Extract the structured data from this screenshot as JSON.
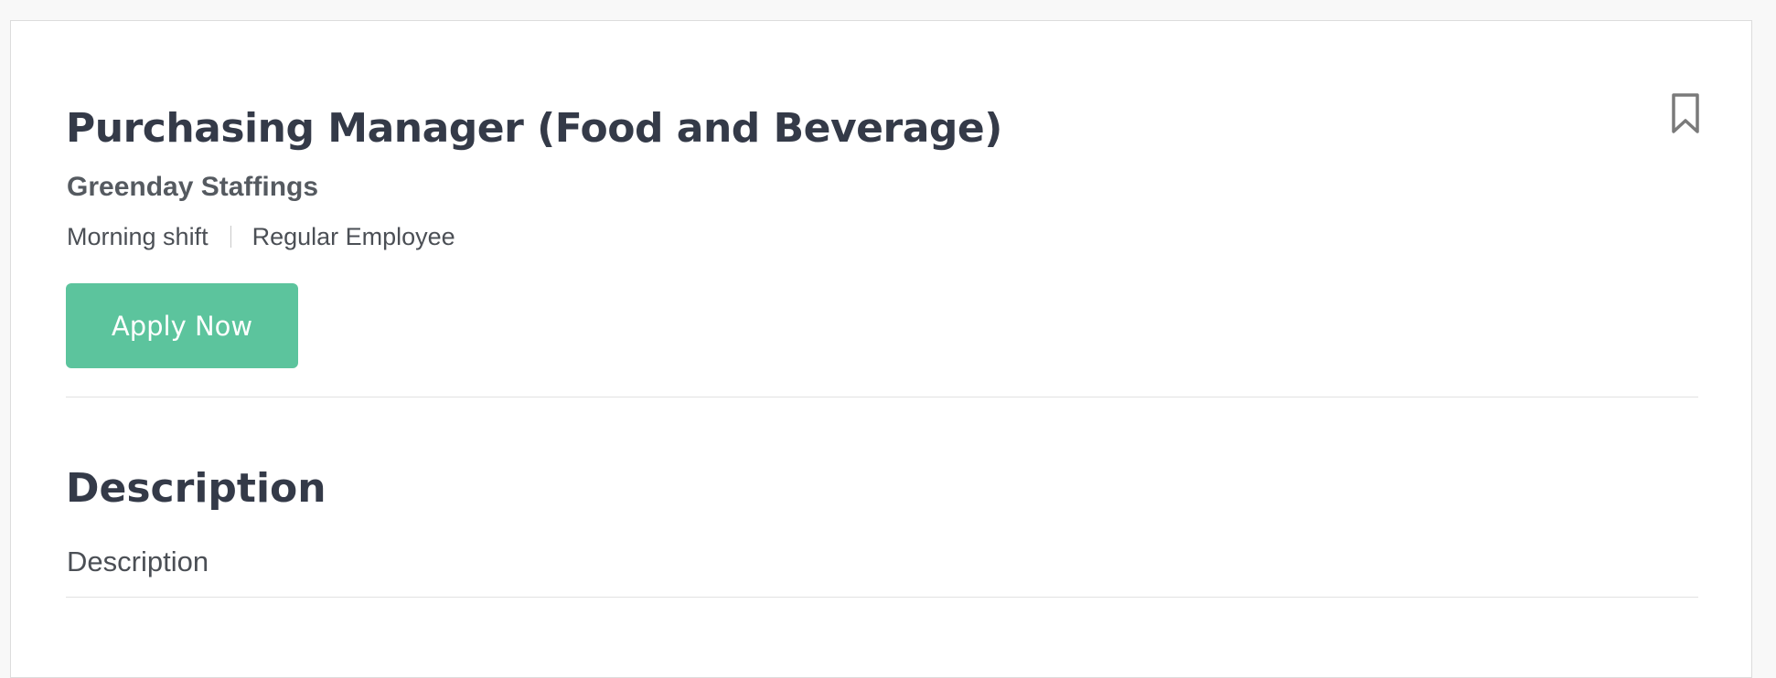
{
  "job": {
    "title": "Purchasing Manager (Food and Beverage)",
    "company": "Greenday Staffings",
    "shift": "Morning shift",
    "employment_type": "Regular Employee",
    "apply_label": "Apply Now",
    "bookmark_icon": "bookmark-icon"
  },
  "description": {
    "heading": "Description",
    "body": "Description"
  },
  "colors": {
    "accent": "#5cc49d",
    "title_text": "#343a48",
    "body_text": "#4b4f55"
  }
}
